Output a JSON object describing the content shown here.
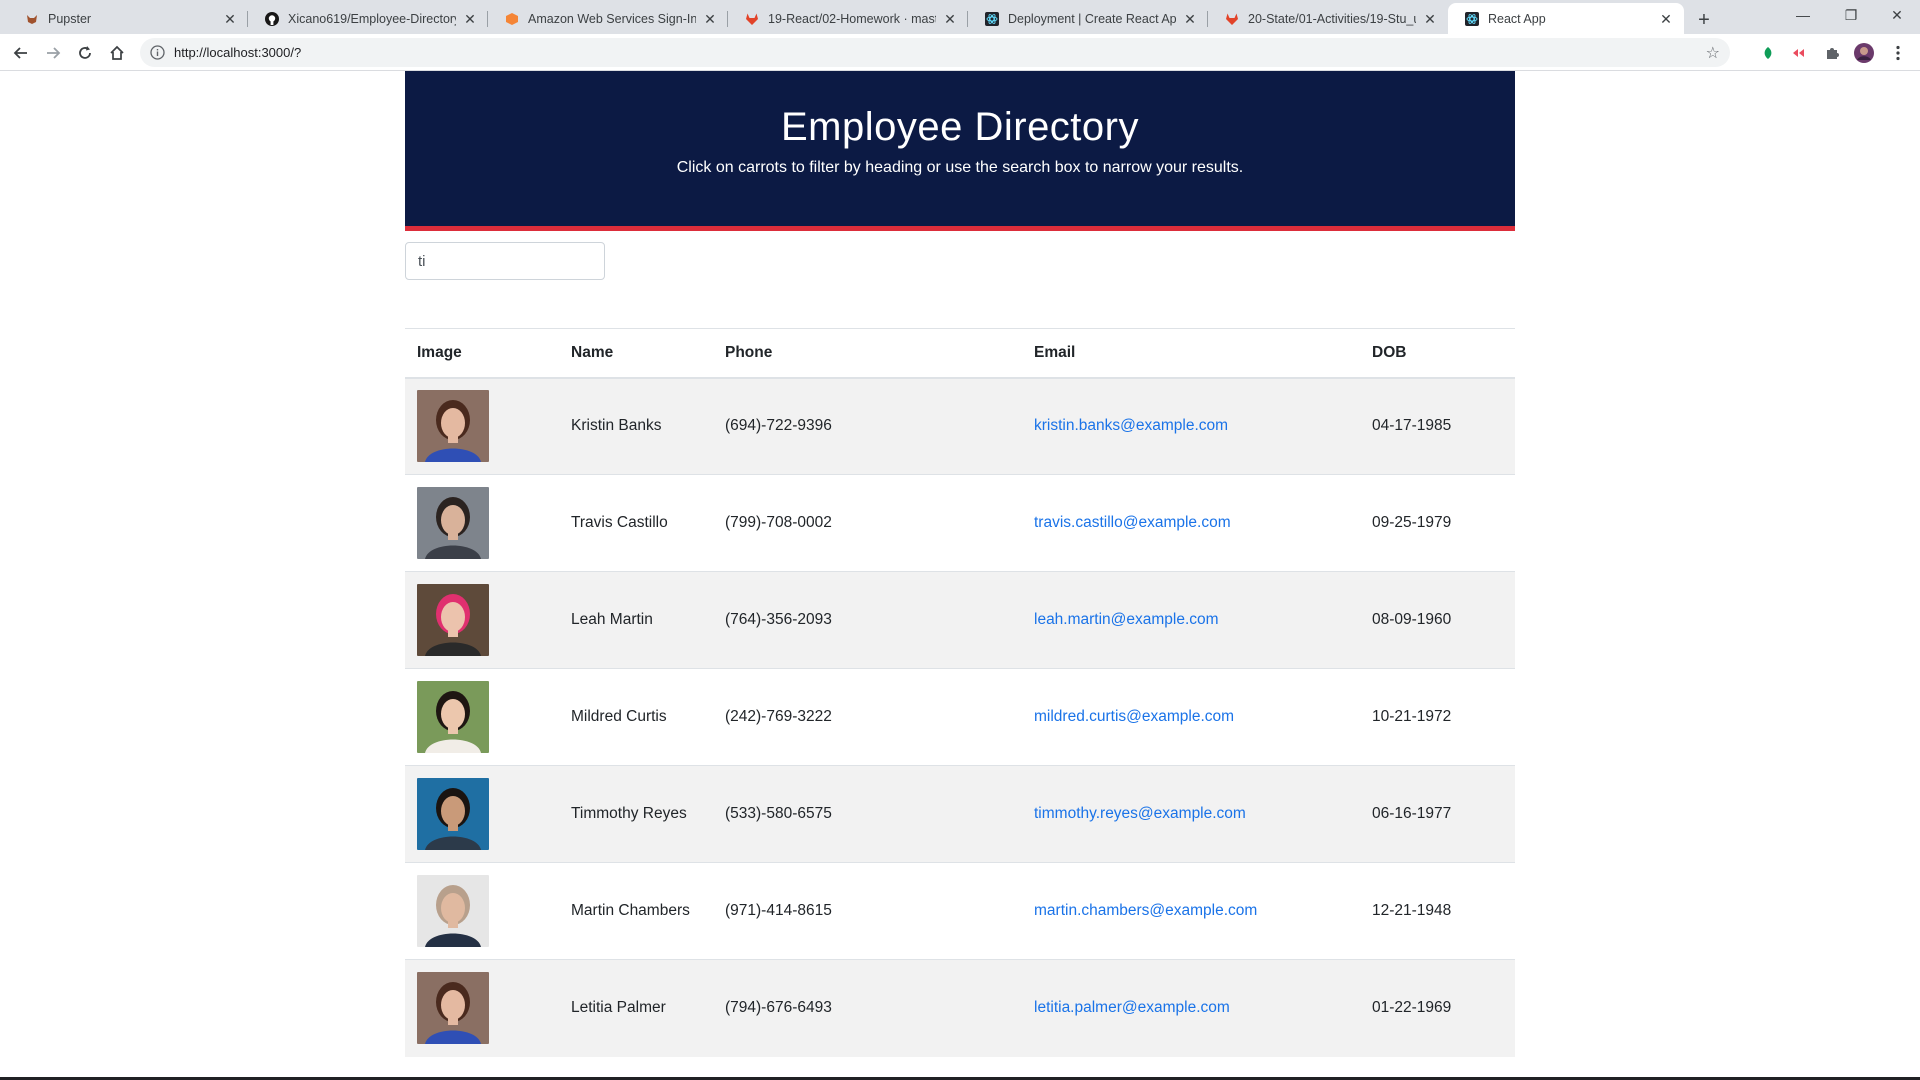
{
  "browser": {
    "tabs": [
      {
        "title": "Pupster",
        "icon": "dog-icon",
        "active": false
      },
      {
        "title": "Xicano619/Employee-Directory: /",
        "icon": "github-icon",
        "active": false
      },
      {
        "title": "Amazon Web Services Sign-In",
        "icon": "aws-icon",
        "active": false
      },
      {
        "title": "19-React/02-Homework · master",
        "icon": "gitlab-icon",
        "active": false
      },
      {
        "title": "Deployment | Create React App",
        "icon": "react-icon",
        "active": false
      },
      {
        "title": "20-State/01-Activities/19-Stu_use",
        "icon": "gitlab-icon",
        "active": false
      },
      {
        "title": "React App",
        "icon": "react-icon",
        "active": true
      }
    ],
    "url": "http://localhost:3000/?"
  },
  "header": {
    "title": "Employee Directory",
    "subtitle": "Click on carrots to filter by heading or use the search box to narrow your results."
  },
  "search": {
    "value": "ti"
  },
  "table": {
    "columns": [
      "Image",
      "Name",
      "Phone",
      "Email",
      "DOB"
    ],
    "rows": [
      {
        "name": "Kristin Banks",
        "phone": "(694)-722-9396",
        "email": "kristin.banks@example.com",
        "dob": "04-17-1985",
        "avatar": {
          "bg": "#8a6f63",
          "skin": "#e4b9a1",
          "hair": "#4a2a1e",
          "shirt": "#2f4fb5"
        }
      },
      {
        "name": "Travis Castillo",
        "phone": "(799)-708-0002",
        "email": "travis.castillo@example.com",
        "dob": "09-25-1979",
        "avatar": {
          "bg": "#7e848c",
          "skin": "#d9b29a",
          "hair": "#2b2320",
          "shirt": "#3b3f48"
        }
      },
      {
        "name": "Leah Martin",
        "phone": "(764)-356-2093",
        "email": "leah.martin@example.com",
        "dob": "08-09-1960",
        "avatar": {
          "bg": "#5e4a3a",
          "skin": "#ecc3ad",
          "hair": "#e0306f",
          "shirt": "#2a2a2a"
        }
      },
      {
        "name": "Mildred Curtis",
        "phone": "(242)-769-3222",
        "email": "mildred.curtis@example.com",
        "dob": "10-21-1972",
        "avatar": {
          "bg": "#7a9a5a",
          "skin": "#ecc7ad",
          "hair": "#1e1612",
          "shirt": "#f1ede7"
        }
      },
      {
        "name": "Timmothy Reyes",
        "phone": "(533)-580-6575",
        "email": "timmothy.reyes@example.com",
        "dob": "06-16-1977",
        "avatar": {
          "bg": "#1f6fa3",
          "skin": "#c99a79",
          "hair": "#1a1411",
          "shirt": "#2c3a4a"
        }
      },
      {
        "name": "Martin Chambers",
        "phone": "(971)-414-8615",
        "email": "martin.chambers@example.com",
        "dob": "12-21-1948",
        "avatar": {
          "bg": "#e6e6e6",
          "skin": "#e0b9a0",
          "hair": "#b8a08c",
          "shirt": "#243044"
        }
      },
      {
        "name": "Letitia Palmer",
        "phone": "(794)-676-6493",
        "email": "letitia.palmer@example.com",
        "dob": "01-22-1969",
        "avatar": {
          "bg": "#8a6f63",
          "skin": "#e4b9a1",
          "hair": "#4a2a1e",
          "shirt": "#2f4fb5"
        }
      }
    ]
  }
}
